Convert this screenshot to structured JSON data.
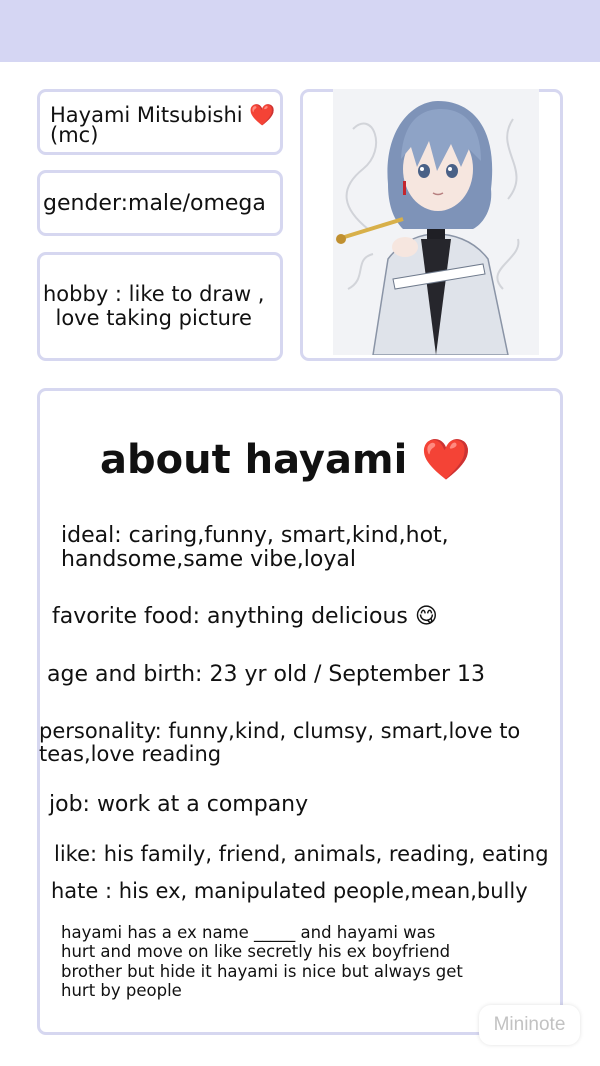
{
  "profile": {
    "name": "Hayami Mitsubishi ❤️\n(mc)",
    "gender": "gender:male/omega",
    "hobby": "hobby : like to draw ,\nlove taking picture"
  },
  "about": {
    "title": "about hayami ❤️",
    "ideal": "ideal: caring,funny, smart,kind,hot,\nhandsome,same vibe,loyal",
    "favorite_food": "favorite food: anything delicious 😋",
    "age_birth": "age and birth: 23 yr old / September 13",
    "personality": "personality: funny,kind, clumsy, smart,love to\nteas,love reading",
    "job": "job: work at a company",
    "like": "like: his family, friend, animals, reading, eating",
    "hate": "hate : his ex, manipulated people,mean,bully",
    "story": "hayami has a ex name _____ and hayami was\nhurt and move on like secretly his ex boyfriend\nbrother but hide it hayami is nice but always get\nhurt by people"
  },
  "watermark": "Mininote"
}
